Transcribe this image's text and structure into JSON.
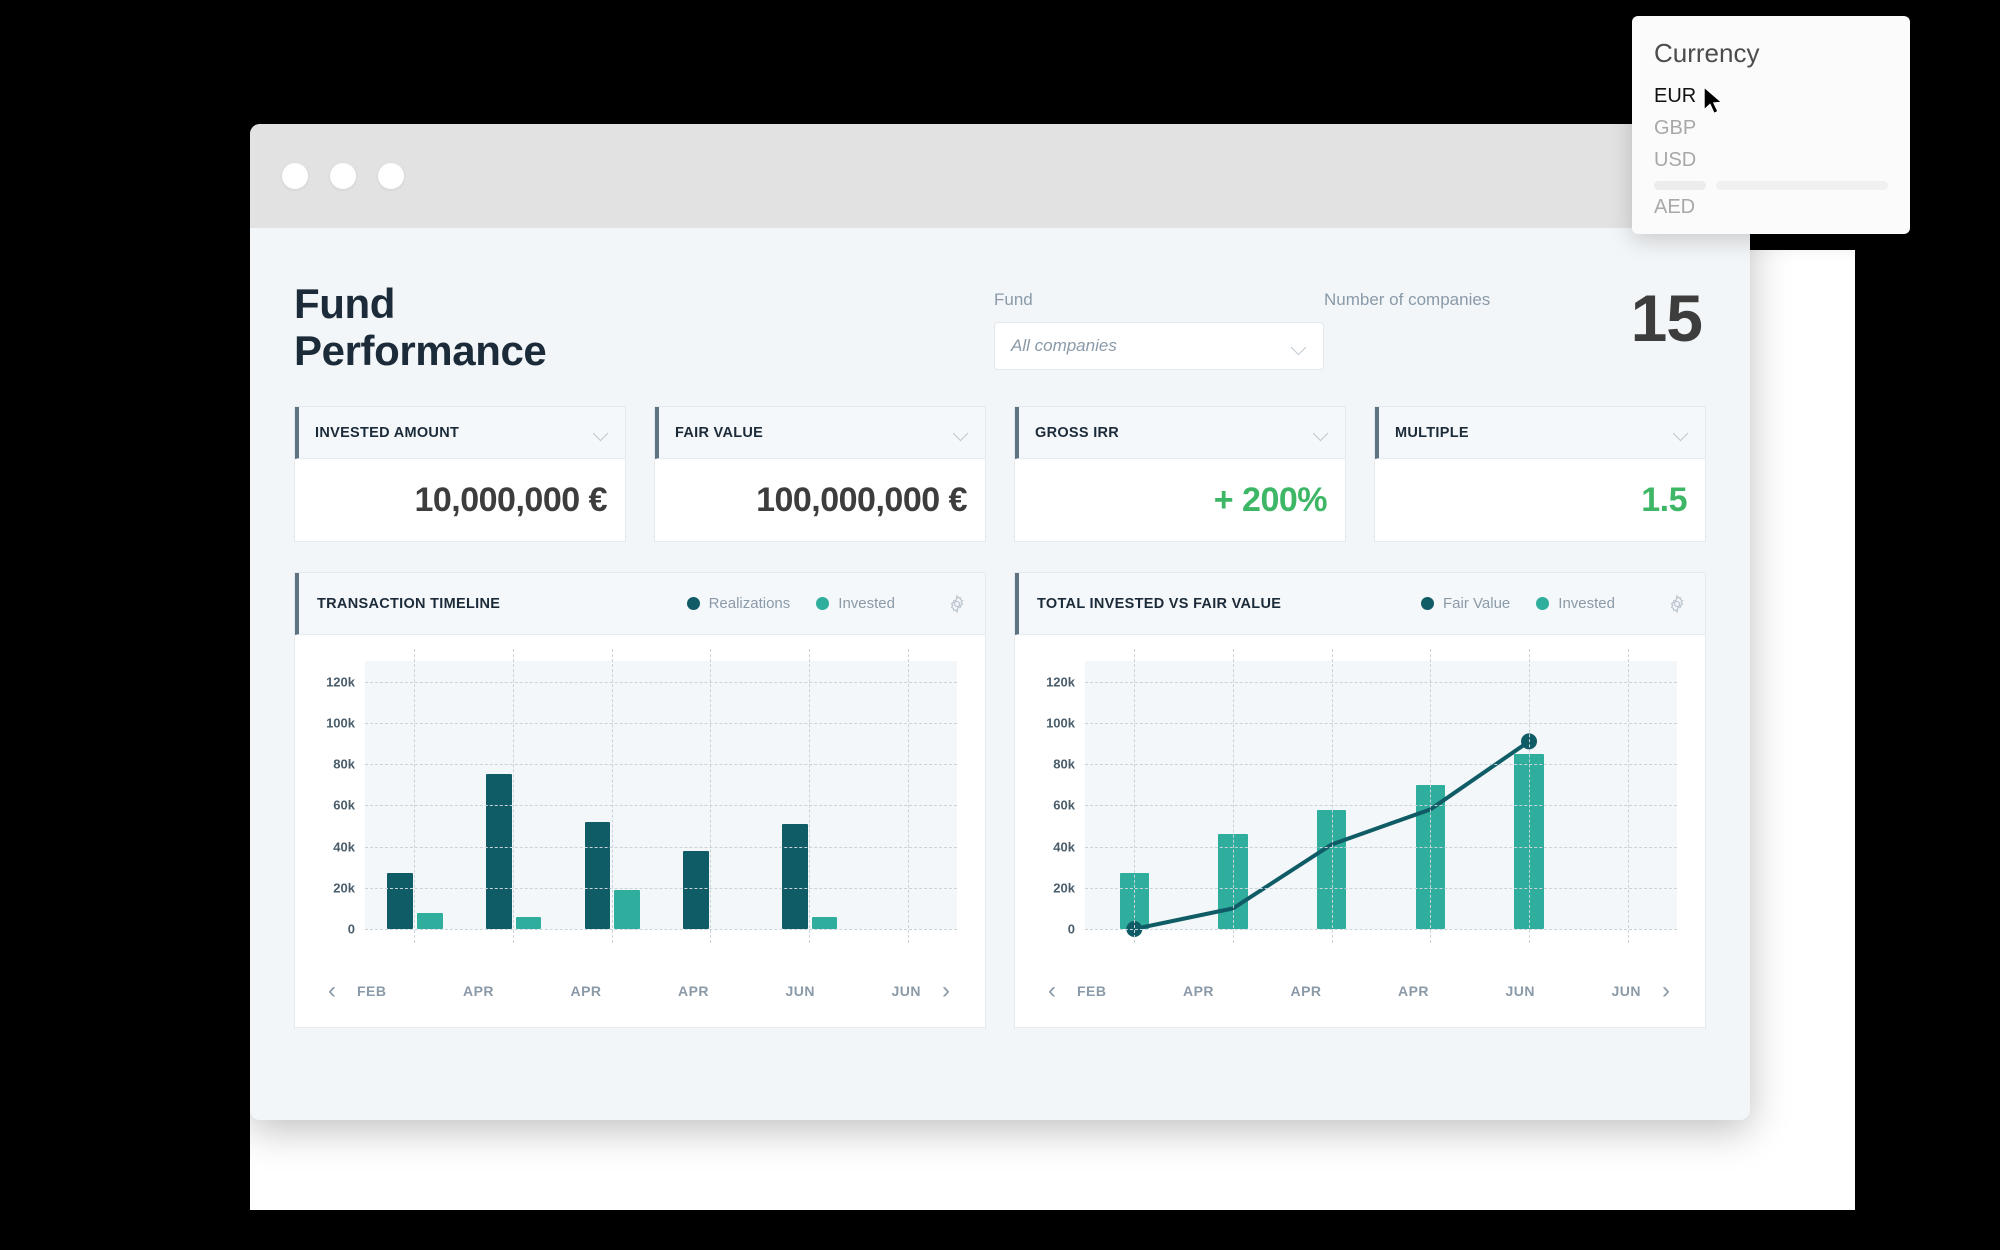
{
  "window": {
    "traffic_lights": [
      "close",
      "minimize",
      "maximize"
    ]
  },
  "header": {
    "title_line1": "Fund",
    "title_line2": "Performance",
    "fund_label": "Fund",
    "fund_value": "All companies",
    "companies_label": "Number of companies",
    "companies_count": "15"
  },
  "kpis": [
    {
      "label": "INVESTED AMOUNT",
      "value": "10,000,000 €",
      "positive": false
    },
    {
      "label": "FAIR VALUE",
      "value": "100,000,000 €",
      "positive": false
    },
    {
      "label": "GROSS IRR",
      "value": "+ 200%",
      "positive": true
    },
    {
      "label": "MULTIPLE",
      "value": "1.5",
      "positive": true
    }
  ],
  "charts": [
    {
      "title": "TRANSACTION TIMELINE",
      "legend": [
        {
          "label": "Realizations",
          "color": "#0f5c66"
        },
        {
          "label": "Invested",
          "color": "#2fae9e"
        }
      ],
      "prev_label": "‹",
      "next_label": "›"
    },
    {
      "title": "TOTAL INVESTED VS FAIR VALUE",
      "legend": [
        {
          "label": "Fair Value",
          "color": "#0f5c66"
        },
        {
          "label": "Invested",
          "color": "#2fae9e"
        }
      ],
      "prev_label": "‹",
      "next_label": "›"
    }
  ],
  "currency_menu": {
    "title": "Currency",
    "items": [
      "EUR",
      "GBP",
      "USD"
    ],
    "selected": "EUR",
    "extra_item": "AED"
  },
  "colors": {
    "dark_teal": "#0f5c66",
    "teal": "#2fae9e",
    "green": "#3db665",
    "ink": "#1c2b39",
    "muted": "#8a9aa8"
  },
  "chart_data": [
    {
      "type": "bar",
      "title": "TRANSACTION TIMELINE",
      "categories": [
        "FEB",
        "APR",
        "APR",
        "APR",
        "JUN",
        "JUN"
      ],
      "series": [
        {
          "name": "Realizations",
          "color": "#0f5c66",
          "values": [
            27000,
            75000,
            52000,
            38000,
            51000,
            null
          ]
        },
        {
          "name": "Invested",
          "color": "#2fae9e",
          "values": [
            8000,
            6000,
            19000,
            0,
            6000,
            null
          ]
        }
      ],
      "xlabel": "",
      "ylabel": "",
      "ylim": [
        0,
        130000
      ],
      "yticks": [
        0,
        20000,
        40000,
        60000,
        80000,
        100000,
        120000
      ],
      "ytick_labels": [
        "0",
        "20k",
        "40k",
        "60k",
        "80k",
        "100k",
        "120k"
      ],
      "grid": true,
      "legend_position": "top-right"
    },
    {
      "type": "bar+line",
      "title": "TOTAL INVESTED VS FAIR VALUE",
      "categories": [
        "FEB",
        "APR",
        "APR",
        "APR",
        "JUN",
        "JUN"
      ],
      "series": [
        {
          "name": "Invested",
          "type": "bar",
          "color": "#2fae9e",
          "values": [
            27000,
            46000,
            58000,
            70000,
            85000,
            null
          ]
        },
        {
          "name": "Fair Value",
          "type": "line",
          "color": "#0f5c66",
          "values": [
            0,
            10000,
            41000,
            58000,
            91000,
            null
          ]
        }
      ],
      "xlabel": "",
      "ylabel": "",
      "ylim": [
        0,
        130000
      ],
      "yticks": [
        0,
        20000,
        40000,
        60000,
        80000,
        100000,
        120000
      ],
      "ytick_labels": [
        "0",
        "20k",
        "40k",
        "60k",
        "80k",
        "100k",
        "120k"
      ],
      "grid": true,
      "legend_position": "top-right"
    }
  ]
}
